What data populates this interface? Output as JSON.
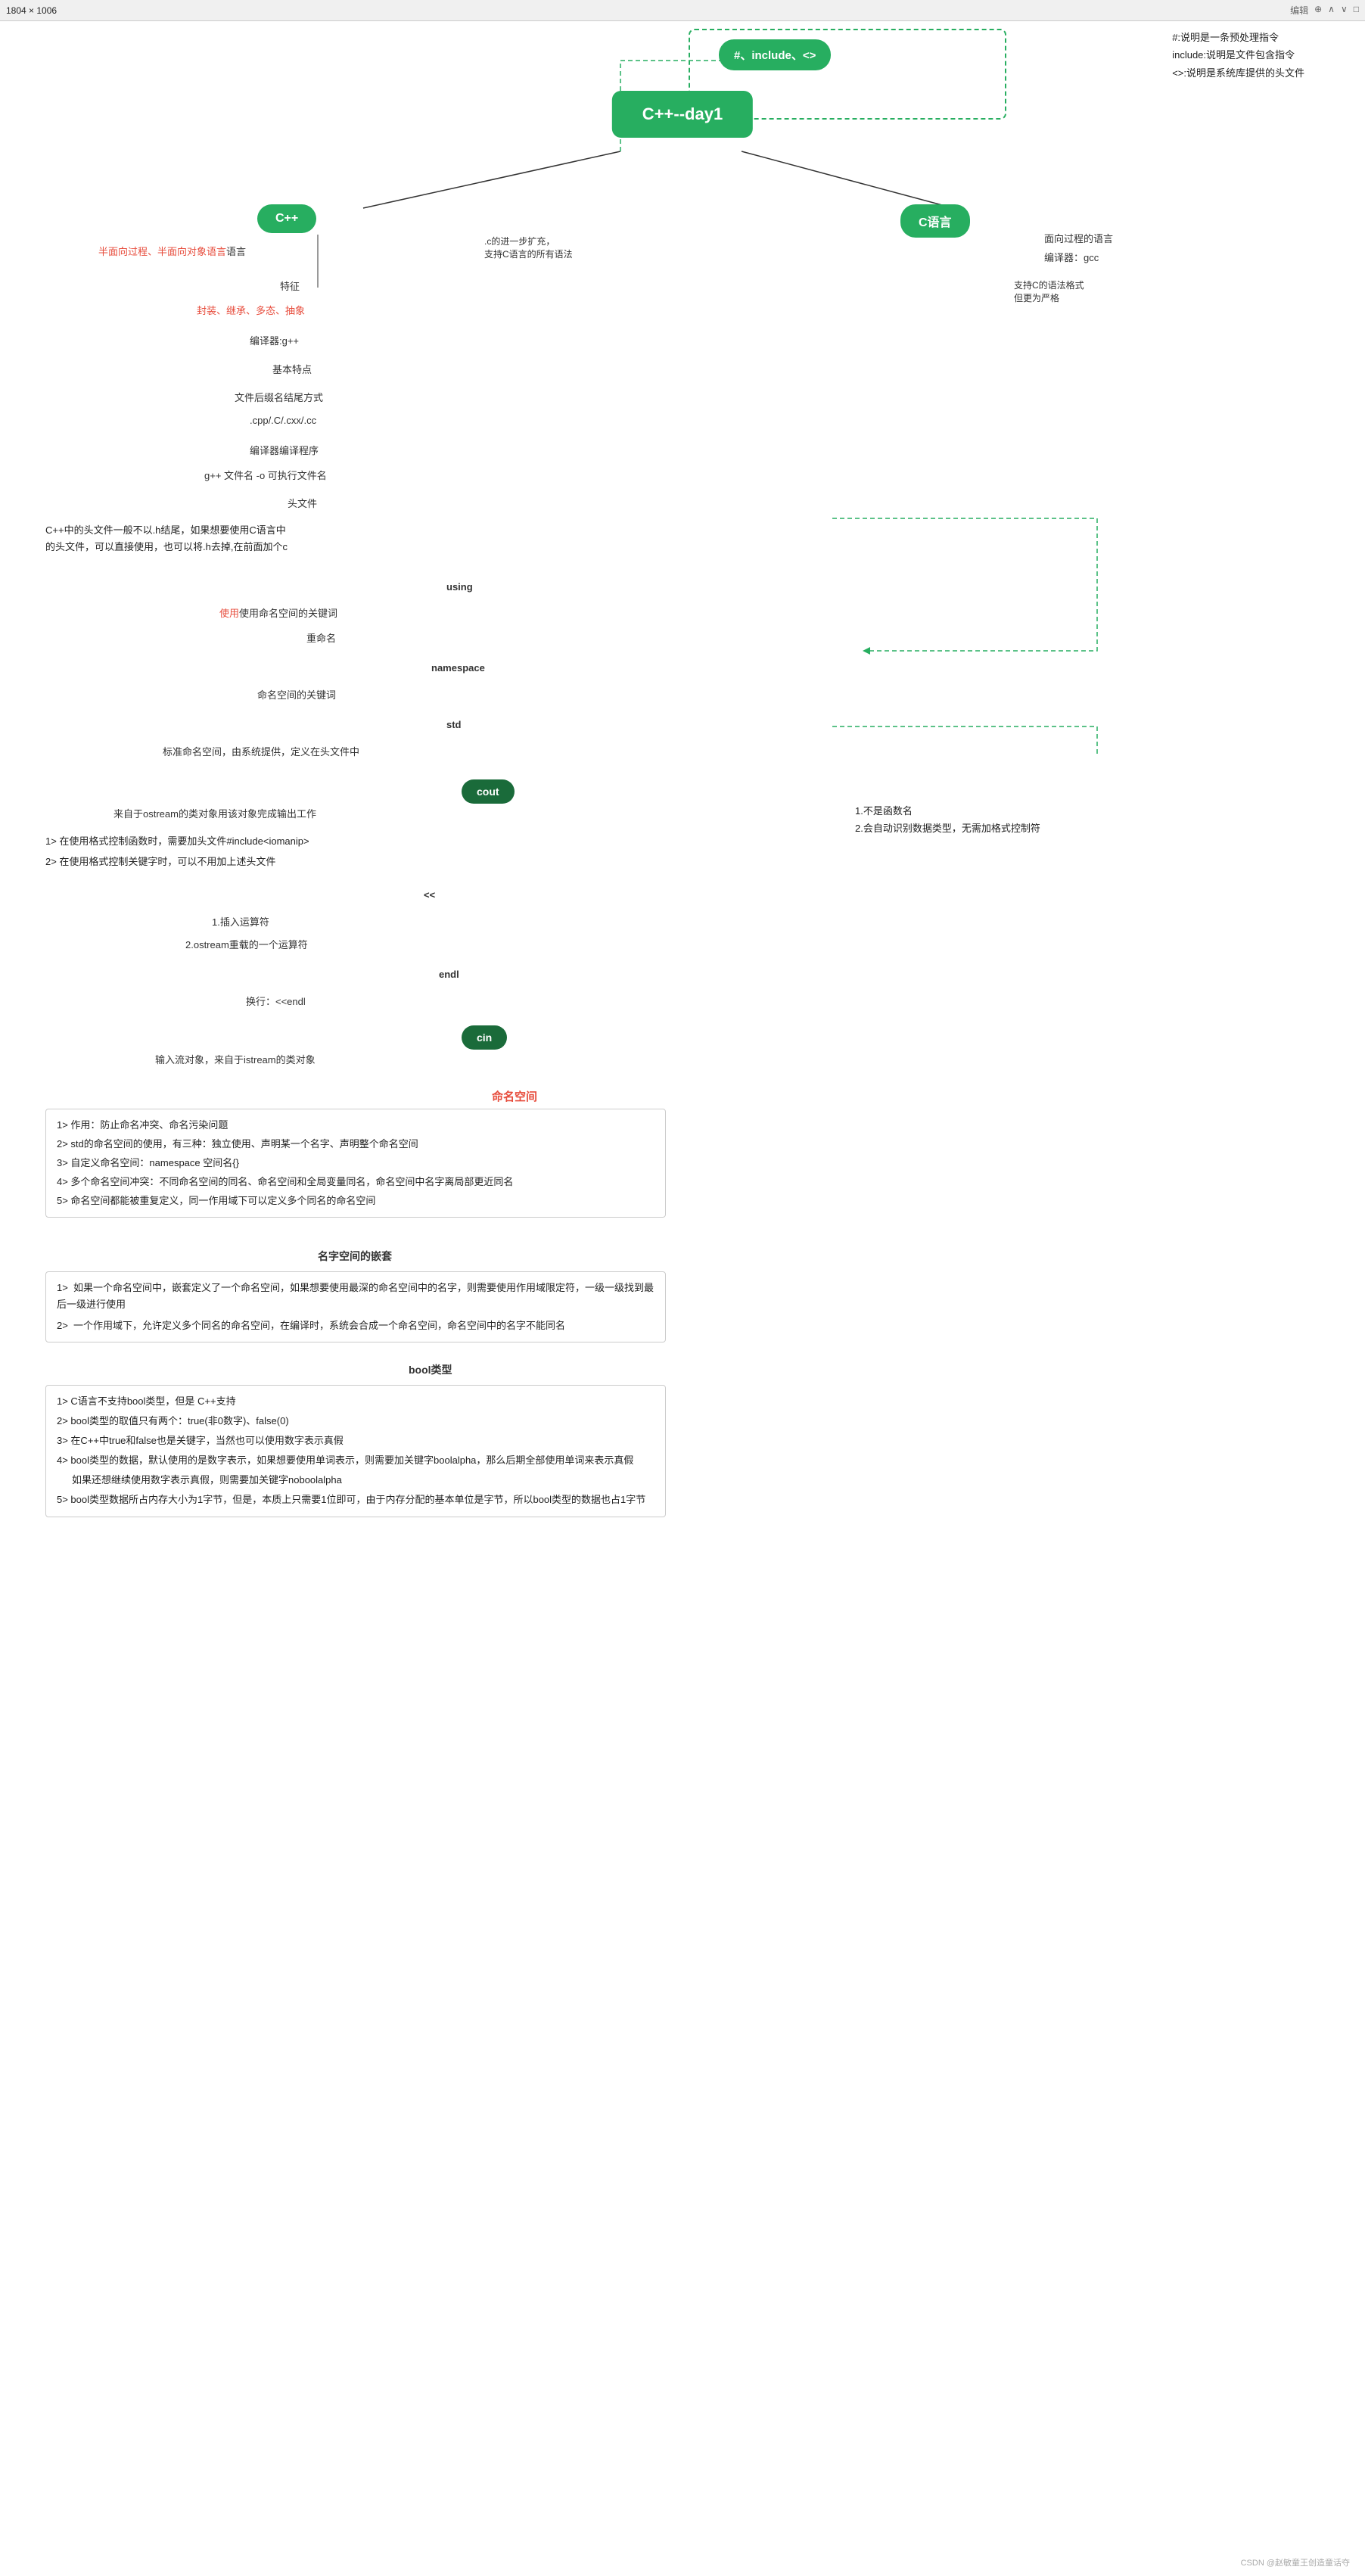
{
  "topbar": {
    "left": "1804 × 1006",
    "right_items": [
      "编辑",
      "⊕",
      "∧",
      "∨",
      "□"
    ]
  },
  "central_node": "C++--day1",
  "cpp_node": "C++",
  "c_node": "C语言",
  "keyword_node": "#、include、<>",
  "annotations": [
    "#:说明是一条预处理指令",
    "include:说明是文件包含指令",
    "<>:说明是系统库提供的头文件"
  ],
  "cpp_desc": "半面向过程、半面向对象语言",
  "cpp_feature_label": "特征",
  "cpp_features": "封装、继承、多态、抽象",
  "compiler_label": "编译器:g++",
  "basic_features_label": "基本特点",
  "file_suffix_label": "文件后缀名结尾方式",
  "file_suffix_value": ".cpp/.C/.cxx/.cc",
  "compile_program_label": "编译器编译程序",
  "compile_cmd": "g++ 文件名 -o 可执行文件名",
  "header_label": "头文件",
  "header_desc": "C++中的头文件一般不以.h结尾，如果想要使用C语言中\n的头文件，可以直接使用，也可以将.h去掉,在前面加个c",
  "c_desc1": "面向过程的语言",
  "c_desc2": "编译器：gcc",
  "c_extend_desc": ".c的进一步扩充，\n支持C语言的所有语法",
  "c_grammar_support": "支持C的语法格式\n但更为严格",
  "using_label": "using",
  "using_keyword_label": "使用命名空间的关键词",
  "rename_label": "重命名",
  "namespace_label": "namespace",
  "namespace_keyword_label": "命名空间的关键词",
  "std_label": "std",
  "std_desc": "标准命名空间，由系统提供，定义在头文件中",
  "cout_label": "cout",
  "cout_desc": "来自于ostream的类对象用该对象完成输出工作",
  "cout_note1": "1>  在使用格式控制函数时，需要加头文件#include<iomanip>",
  "cout_note2": "2>  在使用格式控制关键字时，可以不用加上述头文件",
  "cout_right1": "1.不是函数名",
  "cout_right2": "2.会自动识别数据类型，无需加格式控制符",
  "lshift_label": "<<",
  "lshift_desc1": "1.插入运算符",
  "lshift_desc2": "2.ostream重载的一个运算符",
  "endl_label": "endl",
  "endl_desc": "换行：<<endl",
  "cin_label": "cin",
  "cin_desc": "输入流对象，来自于istream的类对象",
  "naming_space_heading": "命名空间",
  "naming_space_items": [
    "1>  作用：防止命名冲突、命名污染问题",
    "2>  std的命名空间的使用，有三种：独立使用、声明某一个名字、声明整个命名空间",
    "3>  自定义命名空间：namespace 空间名{}",
    "4>  多个命名空间冲突：不同命名空间的同名、命名空间和全局变量同名，命名空间中名字离局部更近同名",
    "5>  命名空间都能被重复定义，同一作用域下可以定义多个同名的命名空间"
  ],
  "nested_ns_heading": "名字空间的嵌套",
  "nested_ns_items": [
    "1>  如果一个命名空间中，嵌套定义了一个命名空间，如果想要使用最深的命名空间中的名字，则需要使用作用域限定符，一级一级找到最后一级进行使用",
    "2>  一个作用域下，允许定义多个同名的命名空间，在编译时，系统会合成一个命名空间，命名空间中的名字不能同名"
  ],
  "bool_label": "bool类型",
  "bool_items": [
    "1>  C语言不支持bool类型，但是 C++支持",
    "2>  bool类型的取值只有两个：true(非0数字)、false(0)",
    "3>  在C++中true和false也是关键字，当然也可以使用数字表示真假",
    "4>  bool类型的数据，默认使用的是数字表示，如果想要使用单词表示，则需要加关键字boolalpha，那么后期全部使用单词来表示真假",
    "    如果还想继续使用数字表示真假，则需要加关键字noboolalpha",
    "5>  bool类型数据所占内存大小为1字节，但是，本质上只需要1位即可，由于内存分配的基本单位是字节，所以bool类型的数据也占1字节"
  ],
  "watermark": "CSDN @赵敏童王创造童话夺"
}
